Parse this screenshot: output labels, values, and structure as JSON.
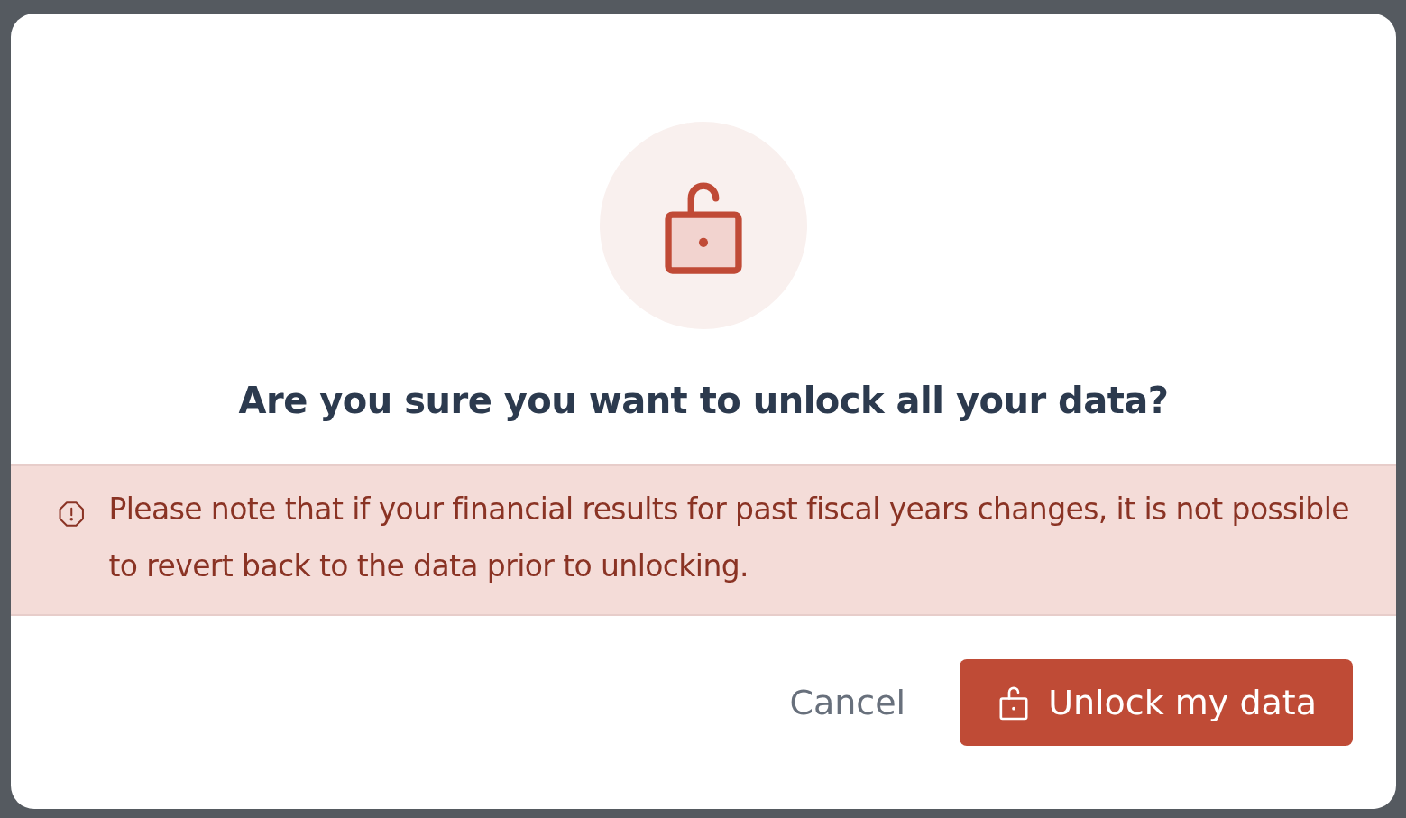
{
  "dialog": {
    "title": "Are you sure you want to unlock all your data?",
    "warning": "Please note that if your financial results for past fiscal years changes, it is not possible to revert back to the data prior to unlocking.",
    "buttons": [
      {
        "kind": "secondary",
        "label": "Cancel"
      },
      {
        "kind": "primary",
        "label": "Unlock my data"
      }
    ]
  }
}
